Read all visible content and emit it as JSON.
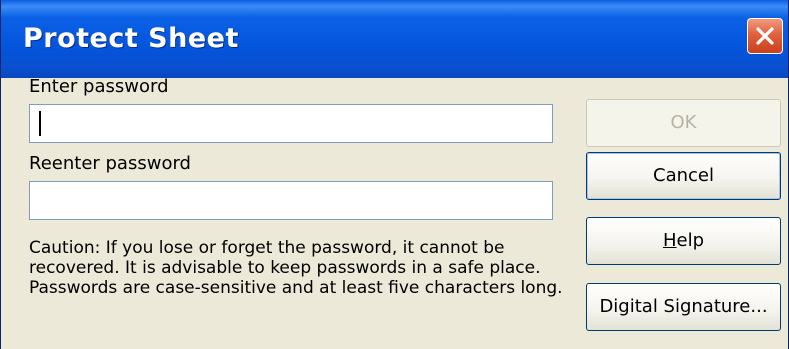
{
  "window": {
    "title": "Protect Sheet",
    "close_icon": "close-x-icon",
    "colors": {
      "titlebar": "#0455dc",
      "close_button": "#e2613e",
      "dialog_bg": "#ece9d8"
    }
  },
  "form": {
    "password_label": "Enter password",
    "password_value": "",
    "reenter_label": "Reenter password",
    "reenter_value": "",
    "caution_text": "Caution: If you lose or forget the password, it cannot be recovered. It is advisable to keep passwords in a safe place. Passwords are case-sensitive and at least five characters long."
  },
  "buttons": {
    "ok_label": "OK",
    "ok_enabled": false,
    "cancel_label": "Cancel",
    "help_mnemonic": "H",
    "help_rest": "elp",
    "digital_signature_label": "Digital Signature..."
  }
}
